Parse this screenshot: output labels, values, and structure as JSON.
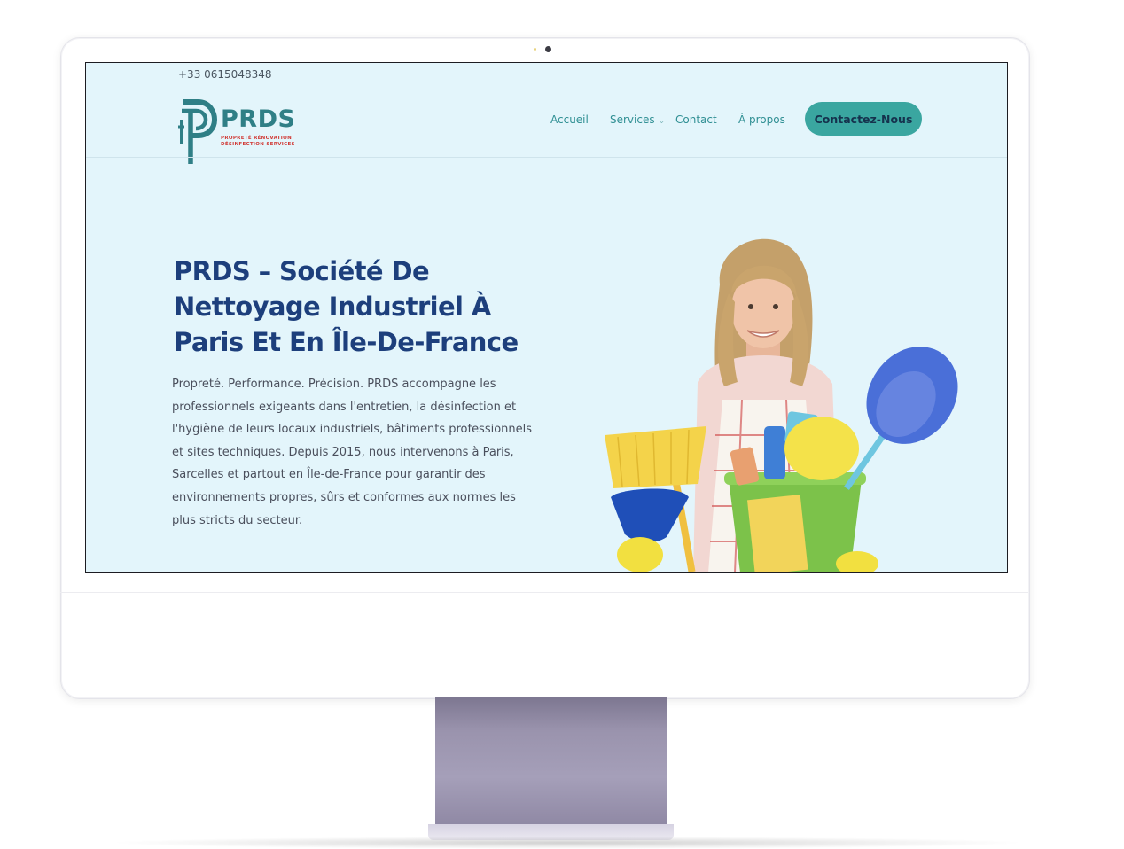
{
  "topbar": {
    "phone": "+33 0615048348"
  },
  "logo": {
    "name": "PRDS",
    "tagline_line1": "PROPRETÉ RÉNOVATION",
    "tagline_line2": "DÉSINFECTION SERVICES"
  },
  "nav": {
    "items": [
      {
        "label": "Accueil"
      },
      {
        "label": "Services",
        "has_dropdown": true
      },
      {
        "label": "Contact"
      },
      {
        "label": "À propos"
      }
    ],
    "cta_label": "Contactez-Nous"
  },
  "hero": {
    "title": "PRDS – Société De Nettoyage Industriel À Paris Et En Île-De-France",
    "text": "Propreté. Performance. Précision. PRDS accompagne les professionnels exigeants dans l'entretien, la désinfection et l'hygiène de leurs locaux industriels, bâtiments professionnels et sites techniques. Depuis 2015, nous intervenons à Paris, Sarcelles et partout en Île-de-France pour garantir des environnements propres, sûrs et conformes aux normes les plus stricts du secteur."
  },
  "colors": {
    "screen_background": "#e3f5fb",
    "brand_teal": "#2f7f86",
    "cta_background": "#3aa6a0",
    "title_navy": "#1d3f7c",
    "tagline_red": "#d13a36",
    "stand_lavender": "#9a93ad"
  },
  "icons": [
    "prds-logo-icon",
    "chevron-down-icon",
    "camera-icon"
  ]
}
